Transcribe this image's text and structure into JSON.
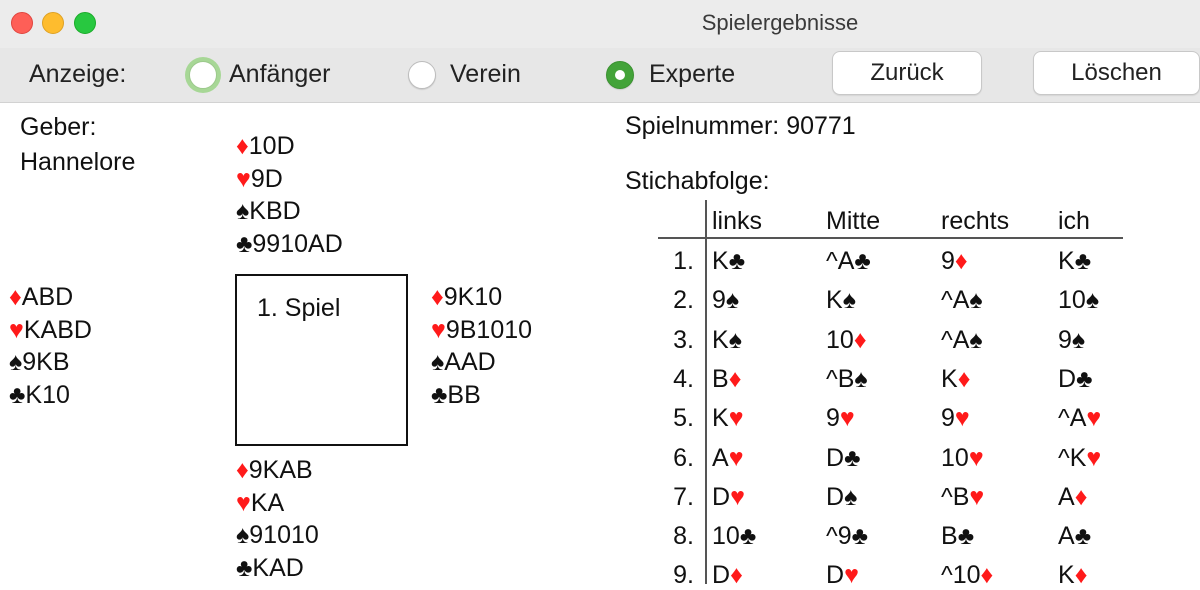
{
  "window": {
    "title": "Spielergebnisse"
  },
  "toolbar": {
    "anzeige_label": "Anzeige:",
    "options": [
      "Anfänger",
      "Verein",
      "Experte"
    ],
    "selected": "Experte",
    "back_button": "Zurück",
    "delete_button": "Löschen"
  },
  "geber": {
    "label": "Geber:",
    "name": "Hannelore"
  },
  "spielnummer": {
    "label": "Spielnummer:",
    "value": "90771"
  },
  "stichabfolge_label": "Stichabfolge:",
  "center_label": "1. Spiel",
  "suits": {
    "diamonds": "♦",
    "hearts": "♥",
    "spades": "♠",
    "clubs": "♣"
  },
  "hands": {
    "top": [
      {
        "suit": "diamonds",
        "cards": "10D"
      },
      {
        "suit": "hearts",
        "cards": "9D"
      },
      {
        "suit": "spades",
        "cards": "KBD"
      },
      {
        "suit": "clubs",
        "cards": "9910AD"
      }
    ],
    "left": [
      {
        "suit": "diamonds",
        "cards": "ABD"
      },
      {
        "suit": "hearts",
        "cards": "KABD"
      },
      {
        "suit": "spades",
        "cards": "9KB"
      },
      {
        "suit": "clubs",
        "cards": "K10"
      }
    ],
    "right": [
      {
        "suit": "diamonds",
        "cards": "9K10"
      },
      {
        "suit": "hearts",
        "cards": "9B1010"
      },
      {
        "suit": "spades",
        "cards": "AAD"
      },
      {
        "suit": "clubs",
        "cards": "BB"
      }
    ],
    "bottom": [
      {
        "suit": "diamonds",
        "cards": "9KAB"
      },
      {
        "suit": "hearts",
        "cards": "KA"
      },
      {
        "suit": "spades",
        "cards": "91010"
      },
      {
        "suit": "clubs",
        "cards": "KAD"
      }
    ]
  },
  "table": {
    "headers": [
      "links",
      "Mitte",
      "rechts",
      "ich"
    ],
    "rows": [
      {
        "n": "1.",
        "cells": [
          {
            "r": "K",
            "s": "clubs"
          },
          {
            "r": "^A",
            "s": "clubs"
          },
          {
            "r": "9",
            "s": "diamonds"
          },
          {
            "r": "K",
            "s": "clubs"
          }
        ]
      },
      {
        "n": "2.",
        "cells": [
          {
            "r": "9",
            "s": "spades"
          },
          {
            "r": "K",
            "s": "spades"
          },
          {
            "r": "^A",
            "s": "spades"
          },
          {
            "r": "10",
            "s": "spades"
          }
        ]
      },
      {
        "n": "3.",
        "cells": [
          {
            "r": "K",
            "s": "spades"
          },
          {
            "r": "10",
            "s": "diamonds"
          },
          {
            "r": "^A",
            "s": "spades"
          },
          {
            "r": "9",
            "s": "spades"
          }
        ]
      },
      {
        "n": "4.",
        "cells": [
          {
            "r": "B",
            "s": "diamonds"
          },
          {
            "r": "^B",
            "s": "spades"
          },
          {
            "r": "K",
            "s": "diamonds"
          },
          {
            "r": "D",
            "s": "clubs"
          }
        ]
      },
      {
        "n": "5.",
        "cells": [
          {
            "r": "K",
            "s": "hearts"
          },
          {
            "r": "9",
            "s": "hearts"
          },
          {
            "r": "9",
            "s": "hearts"
          },
          {
            "r": "^A",
            "s": "hearts"
          }
        ]
      },
      {
        "n": "6.",
        "cells": [
          {
            "r": "A",
            "s": "hearts"
          },
          {
            "r": "D",
            "s": "clubs"
          },
          {
            "r": "10",
            "s": "hearts"
          },
          {
            "r": "^K",
            "s": "hearts"
          }
        ]
      },
      {
        "n": "7.",
        "cells": [
          {
            "r": "D",
            "s": "hearts"
          },
          {
            "r": "D",
            "s": "spades"
          },
          {
            "r": "^B",
            "s": "hearts"
          },
          {
            "r": "A",
            "s": "diamonds"
          }
        ]
      },
      {
        "n": "8.",
        "cells": [
          {
            "r": "10",
            "s": "clubs"
          },
          {
            "r": "^9",
            "s": "clubs"
          },
          {
            "r": "B",
            "s": "clubs"
          },
          {
            "r": "A",
            "s": "clubs"
          }
        ]
      },
      {
        "n": "9.",
        "cells": [
          {
            "r": "D",
            "s": "diamonds"
          },
          {
            "r": "D",
            "s": "hearts"
          },
          {
            "r": "^10",
            "s": "diamonds"
          },
          {
            "r": "K",
            "s": "diamonds"
          }
        ]
      }
    ]
  },
  "colors": {
    "red_suit": "#ff1a1a",
    "black_suit": "#111111",
    "radio_selected": "#43a339"
  }
}
